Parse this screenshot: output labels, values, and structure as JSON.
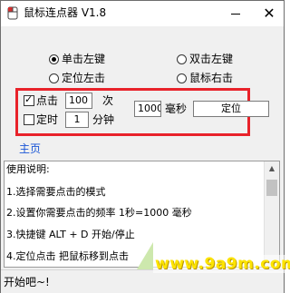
{
  "window": {
    "title": "鼠标连点器 V1.8",
    "close_glyph": "✕",
    "icons": [
      "mouse-icon",
      "minimize-icon",
      "close-icon"
    ]
  },
  "options": {
    "single_left": {
      "label": "单击左键",
      "checked": true
    },
    "double_left": {
      "label": "双击左键",
      "checked": false
    },
    "locate_left": {
      "label": "定位左击",
      "checked": false
    },
    "right_click": {
      "label": "鼠标右击",
      "checked": false
    }
  },
  "click_row": {
    "label": "点击",
    "checked": true,
    "count": "100",
    "unit": "次"
  },
  "timer_row": {
    "label": "定时",
    "checked": false,
    "minutes": "1",
    "unit": "分钟"
  },
  "interval": {
    "value": "1000",
    "unit": "毫秒",
    "locate_button": "定位"
  },
  "home_link": "主页",
  "instructions": [
    "使用说明:",
    "1.选择需要点击的模式",
    "2.设置你需要点击的频率 1秒=1000 毫秒",
    "3.快捷键 ALT + D 开始/停止",
    "4.定位点击 把鼠标移到点击"
  ],
  "status": "开始吧~!",
  "watermark": "www.9a9m.com",
  "colors": {
    "highlight": "#e8222a",
    "link": "#1a55d6",
    "watermark": "#fde400"
  }
}
